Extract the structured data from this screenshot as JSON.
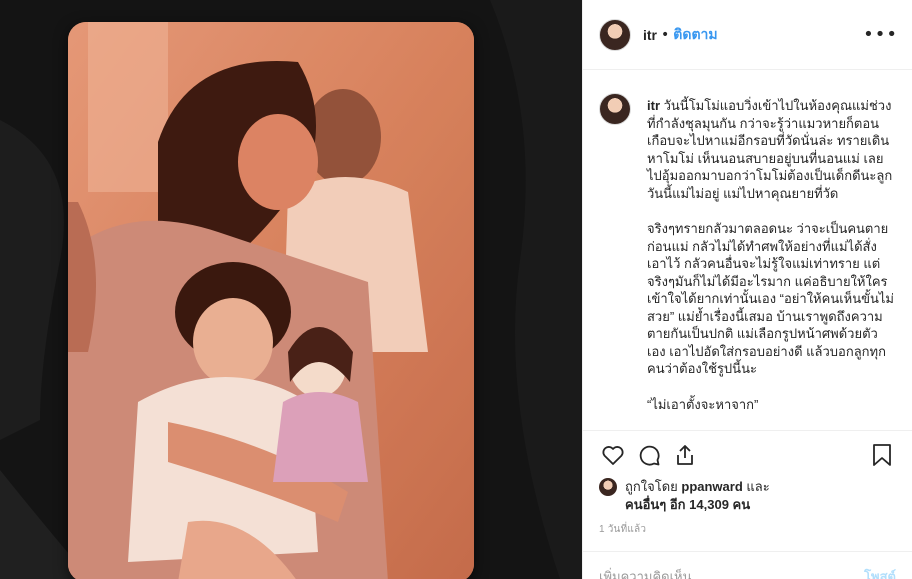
{
  "post": {
    "username": "itr",
    "separator": "•",
    "follow_label": "ติดตาม",
    "more_icon": "more-options-icon"
  },
  "caption": {
    "username": "itr",
    "paragraph_1": "วันนี้โมโม่แอบวิ่งเข้าไปในห้องคุณแม่ช่วงที่กำลังชุลมุนกัน กว่าจะรู้ว่าแมวหายก็ตอนเกือบจะไปหาแม่อีกรอบที่วัดนั่นล่ะ ทรายเดินหาโมโม่ เห็นนอนสบายอยู่บนที่นอนแม่ เลยไปอุ้มออกมาบอกว่าโมโม่ต้องเป็นเด็กดีนะลูก วันนี้แม่ไม่อยู่ แม่ไปหาคุณยายที่วัด",
    "paragraph_2": "จริงๆทรายกลัวมาตลอดนะ ว่าจะเป็นคนตายก่อนแม่ กลัวไม่ได้ทำศพให้อย่างที่แม่ได้สั่งเอาไว้ กลัวคนอื่นจะไม่รู้ใจแม่เท่าทราย แต่จริงๆมันก็ไม่ได้มีอะไรมาก แค่อธิบายให้ใครเข้าใจได้ยากเท่านั้นเอง “อย่าให้คนเห็นขั้นไม่สวย” แม่ย้ำเรื่องนี้เสมอ บ้านเราพูดถึงความตายกันเป็นปกติ แม่เลือกรูปหน้าศพด้วยตัวเอง เอาไปอัดใส่กรอบอย่างดี แล้วบอกลูกทุกคนว่าต้องใช้รูปนี้นะ",
    "paragraph_3": "“ไม่เอาตั้งจะหาจาก”"
  },
  "actions": {
    "like_icon": "heart-icon",
    "comment_icon": "comment-icon",
    "share_icon": "share-icon",
    "save_icon": "bookmark-icon"
  },
  "likes": {
    "prefix": "ถูกใจโดย ",
    "liker": "ppanward",
    "middle": " และ",
    "others": "คนอื่นๆ อีก 14,309 คน"
  },
  "timestamp": "1 วันที่แล้ว",
  "comment": {
    "placeholder": "เพิ่มความคิดเห็น...",
    "post_label": "โพสต์"
  },
  "colors": {
    "link_blue": "#3897f0",
    "post_disabled": "#b2dffc",
    "border": "#efefef",
    "text": "#262626",
    "muted": "#999999"
  }
}
